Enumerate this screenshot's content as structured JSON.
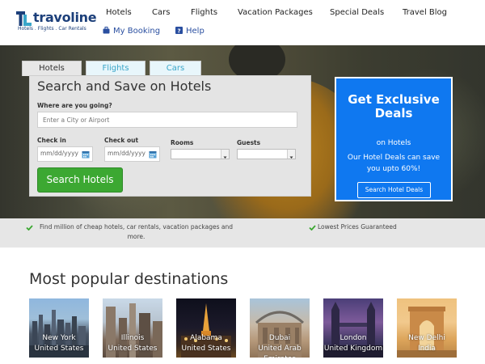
{
  "brand": {
    "name": "travoline",
    "tagline": "Hotels . Flights . Car Rentals",
    "color": "#1c3f7a"
  },
  "nav": {
    "primary": [
      "Hotels",
      "Cars",
      "Flights",
      "Vacation Packages",
      "Special Deals",
      "Travel Blog"
    ],
    "secondary": [
      {
        "label": "My Booking",
        "icon": "briefcase-icon"
      },
      {
        "label": "Help",
        "icon": "help-icon"
      }
    ]
  },
  "search": {
    "tabs": [
      "Hotels",
      "Flights",
      "Cars"
    ],
    "active_tab": "Hotels",
    "title": "Search and Save on Hotels",
    "destination_label": "Where are you going?",
    "destination_placeholder": "Enter a City or Airport",
    "checkin_label": "Check in",
    "checkout_label": "Check out",
    "date_placeholder": "mm/dd/yyyy",
    "rooms_label": "Rooms",
    "guests_label": "Guests",
    "rooms_value": "",
    "guests_value": "",
    "button_label": "Search Hotels",
    "button_color": "#3ca832"
  },
  "deals": {
    "title": "Get Exclusive Deals",
    "subtitle": "on Hotels",
    "text": "Our Hotel Deals can save you upto 60%!",
    "button_label": "Search Hotel Deals",
    "background": "#0f78f0"
  },
  "features": [
    "Find million of cheap hotels, car rentals, vacation packages and more.",
    "Lowest Prices Guaranteed"
  ],
  "destinations_title": "Most popular destinations",
  "destinations": [
    {
      "city": "New York",
      "country": "United States"
    },
    {
      "city": "Illinois",
      "country": "United States"
    },
    {
      "city": "Alabama",
      "country": "United States"
    },
    {
      "city": "Dubai",
      "country": "United Arab Emirates"
    },
    {
      "city": "London",
      "country": "United Kingdom"
    },
    {
      "city": "New Delhi",
      "country": "India"
    }
  ]
}
